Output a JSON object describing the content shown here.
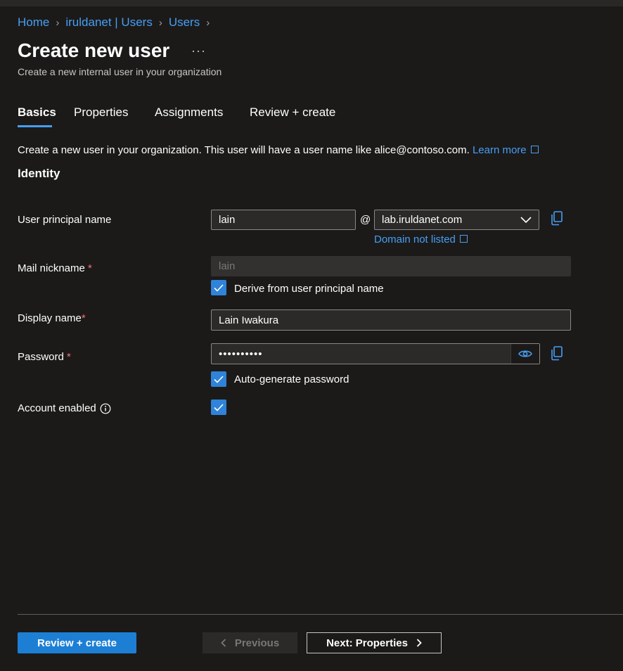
{
  "breadcrumb": [
    "Home",
    "iruldanet | Users",
    "Users"
  ],
  "page": {
    "title": "Create new user",
    "more": "···",
    "subtitle": "Create a new internal user in your organization"
  },
  "tabs": [
    {
      "label": "Basics",
      "active": true
    },
    {
      "label": "Properties"
    },
    {
      "label": "Assignments"
    },
    {
      "label": "Review + create"
    }
  ],
  "intro": {
    "text": "Create a new user in your organization. This user will have a user name like alice@contoso.com.",
    "learn_more": "Learn more"
  },
  "section_title": "Identity",
  "form": {
    "upn": {
      "label": "User principal name",
      "value": "lain",
      "at": "@",
      "domain": "lab.iruldanet.com",
      "domain_not_listed": "Domain not listed"
    },
    "mail_nickname": {
      "label": "Mail nickname",
      "required": "*",
      "value": "lain",
      "derive_label": "Derive from user principal name",
      "derive_checked": true
    },
    "display_name": {
      "label": "Display name",
      "required": "*",
      "value": "Lain Iwakura"
    },
    "password": {
      "label": "Password",
      "required": "*",
      "value": "••••••••••",
      "autogen_label": "Auto-generate password",
      "autogen_checked": true
    },
    "account_enabled": {
      "label": "Account enabled",
      "checked": true
    }
  },
  "footer": {
    "review_create": "Review + create",
    "previous": "Previous",
    "next": "Next: Properties"
  },
  "colors": {
    "background": "#1b1a19",
    "accent": "#479ef5",
    "primary_button": "#1d7fd4",
    "checkbox": "#2f83d8",
    "required": "#f1707b"
  }
}
